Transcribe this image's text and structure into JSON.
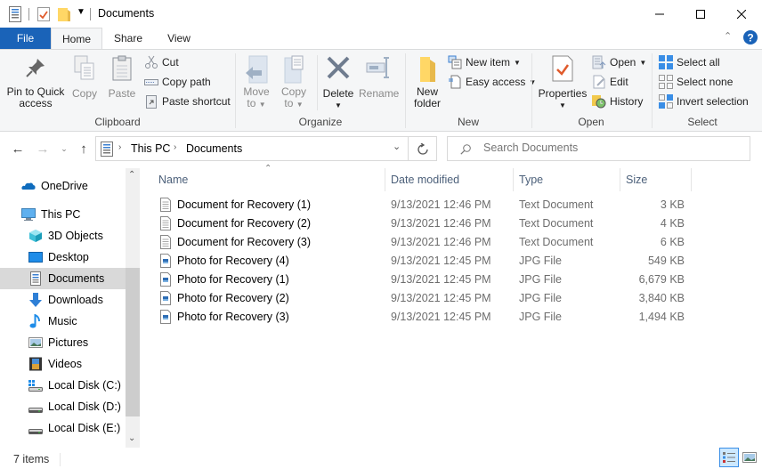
{
  "window": {
    "title": "Documents",
    "controls": {
      "minimize": "minimize-icon",
      "maximize": "maximize-icon",
      "close": "close-icon"
    }
  },
  "ribbon": {
    "tabs": [
      {
        "label": "File",
        "active": false
      },
      {
        "label": "Home",
        "active": true
      },
      {
        "label": "Share",
        "active": false
      },
      {
        "label": "View",
        "active": false
      }
    ],
    "groups": {
      "clipboard": {
        "label": "Clipboard",
        "pin": "Pin to Quick access",
        "pin_line1": "Pin to Quick",
        "pin_line2": "access",
        "copy": "Copy",
        "paste": "Paste",
        "cut": "Cut",
        "copy_path": "Copy path",
        "paste_shortcut": "Paste shortcut"
      },
      "organize": {
        "label": "Organize",
        "move_to_1": "Move",
        "move_to_2": "to",
        "copy_to_1": "Copy",
        "copy_to_2": "to",
        "delete": "Delete",
        "rename": "Rename"
      },
      "new": {
        "label": "New",
        "new_folder_1": "New",
        "new_folder_2": "folder",
        "new_item": "New item",
        "easy_access": "Easy access"
      },
      "open": {
        "label": "Open",
        "properties": "Properties",
        "open": "Open",
        "edit": "Edit",
        "history": "History"
      },
      "select": {
        "label": "Select",
        "select_all": "Select all",
        "select_none": "Select none",
        "invert": "Invert selection"
      }
    }
  },
  "address": {
    "crumbs": [
      "This PC",
      "Documents"
    ],
    "search_placeholder": "Search Documents"
  },
  "nav": {
    "items": [
      {
        "label": "OneDrive",
        "icon": "onedrive-icon"
      },
      {
        "label": "This PC",
        "icon": "this-pc-icon"
      },
      {
        "label": "3D Objects",
        "icon": "3d-objects-icon"
      },
      {
        "label": "Desktop",
        "icon": "desktop-icon"
      },
      {
        "label": "Documents",
        "icon": "documents-icon",
        "selected": true
      },
      {
        "label": "Downloads",
        "icon": "downloads-icon"
      },
      {
        "label": "Music",
        "icon": "music-icon"
      },
      {
        "label": "Pictures",
        "icon": "pictures-icon"
      },
      {
        "label": "Videos",
        "icon": "videos-icon"
      },
      {
        "label": "Local Disk (C:)",
        "icon": "local-disk-c-icon"
      },
      {
        "label": "Local Disk (D:)",
        "icon": "local-disk-icon"
      },
      {
        "label": "Local Disk (E:)",
        "icon": "local-disk-icon"
      }
    ]
  },
  "files": {
    "columns": [
      "Name",
      "Date modified",
      "Type",
      "Size"
    ],
    "rows": [
      {
        "name": "Document for Recovery (1)",
        "date": "9/13/2021 12:46 PM",
        "type": "Text Document",
        "size": "3 KB",
        "kind": "text"
      },
      {
        "name": "Document for Recovery (2)",
        "date": "9/13/2021 12:46 PM",
        "type": "Text Document",
        "size": "4 KB",
        "kind": "text"
      },
      {
        "name": "Document for Recovery (3)",
        "date": "9/13/2021 12:46 PM",
        "type": "Text Document",
        "size": "6 KB",
        "kind": "text"
      },
      {
        "name": "Photo for Recovery (4)",
        "date": "9/13/2021 12:45 PM",
        "type": "JPG File",
        "size": "549 KB",
        "kind": "jpg"
      },
      {
        "name": "Photo for Recovery (1)",
        "date": "9/13/2021 12:45 PM",
        "type": "JPG File",
        "size": "6,679 KB",
        "kind": "jpg"
      },
      {
        "name": "Photo for Recovery (2)",
        "date": "9/13/2021 12:45 PM",
        "type": "JPG File",
        "size": "3,840 KB",
        "kind": "jpg"
      },
      {
        "name": "Photo for Recovery (3)",
        "date": "9/13/2021 12:45 PM",
        "type": "JPG File",
        "size": "1,494 KB",
        "kind": "jpg"
      }
    ]
  },
  "status": {
    "count": "7 items"
  },
  "colors": {
    "accent": "#1a63b8",
    "selected": "#cce8ff"
  }
}
